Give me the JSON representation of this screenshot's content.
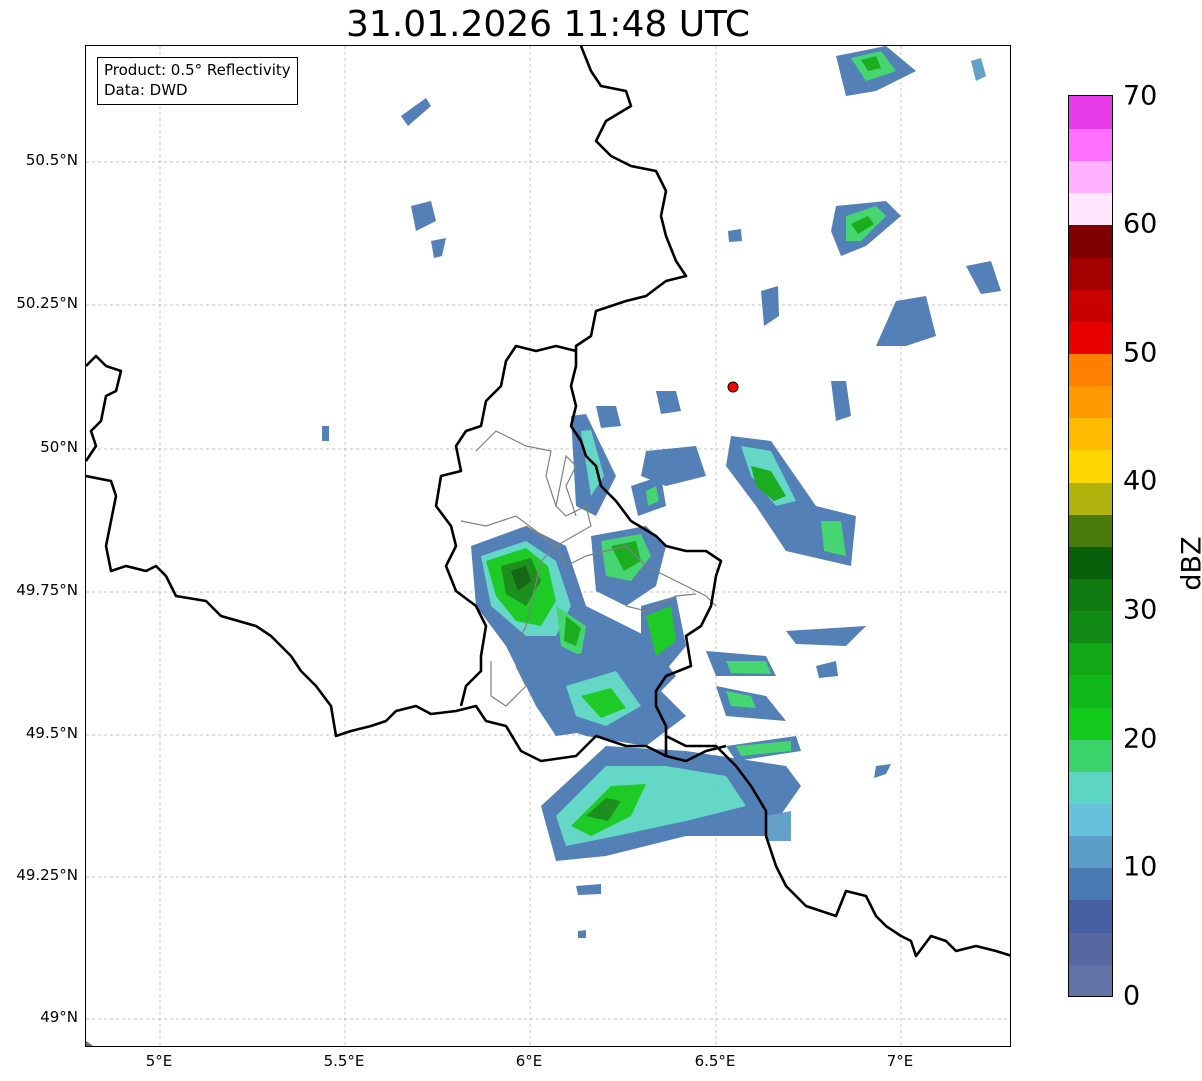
{
  "title": "31.01.2026 11:48 UTC",
  "info_box": {
    "product": "Product: 0.5° Reflectivity",
    "data": "Data: DWD"
  },
  "lat_labels": [
    "50.5°N",
    "50.25°N",
    "50°N",
    "49.75°N",
    "49.5°N",
    "49.25°N",
    "49°N"
  ],
  "lon_labels": [
    "5°E",
    "5.5°E",
    "6°E",
    "6.5°E",
    "7°E"
  ],
  "map": {
    "lon_range": [
      4.8,
      7.3
    ],
    "lat_range": [
      48.95,
      50.7
    ],
    "grid": true,
    "radar_site": {
      "lon": 6.55,
      "lat": 50.11,
      "color": "#ff0000"
    },
    "borders": {
      "country": "#000000",
      "subdivision": "#808080"
    }
  },
  "colorbar": {
    "label": "dBZ",
    "min": 0,
    "max": 70,
    "tick_labels": [
      "0",
      "10",
      "20",
      "30",
      "40",
      "50",
      "60",
      "70"
    ],
    "colors": [
      "#6473a6",
      "#56689f",
      "#4660a3",
      "#4a7ab3",
      "#5b9dc6",
      "#65c1dc",
      "#5dd5c3",
      "#3cd46a",
      "#13c91b",
      "#11b81b",
      "#10a814",
      "#108a14",
      "#0f7a0f",
      "#0a5f0a",
      "#4a7a0d",
      "#afb30b",
      "#ffd700",
      "#ffbc00",
      "#ff9b00",
      "#ff7f00",
      "#e60000",
      "#c80000",
      "#a50000",
      "#800000",
      "#ffe6ff",
      "#ffb1ff",
      "#ff6fff",
      "#e93ce9"
    ]
  }
}
